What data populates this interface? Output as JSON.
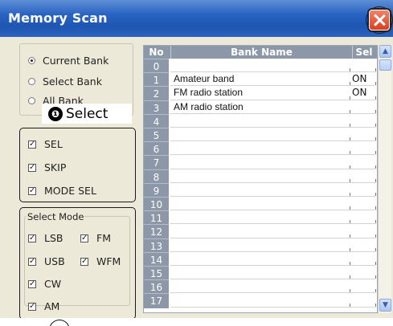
{
  "window": {
    "title": "Memory Scan"
  },
  "scan_target": {
    "options": [
      "Current Bank",
      "Select Bank",
      "All Bank"
    ],
    "selected_index": 0
  },
  "callout": {
    "number": "❶",
    "label": "Select"
  },
  "scan_options": [
    {
      "label": "SEL",
      "checked": true
    },
    {
      "label": "SKIP",
      "checked": true
    },
    {
      "label": "MODE SEL",
      "checked": true
    }
  ],
  "select_mode": {
    "legend": "Select Mode",
    "modes": [
      {
        "label": "LSB",
        "checked": true
      },
      {
        "label": "FM",
        "checked": true
      },
      {
        "label": "USB",
        "checked": true
      },
      {
        "label": "WFM",
        "checked": true
      },
      {
        "label": "CW",
        "checked": true
      },
      {
        "label": "AM",
        "checked": true
      }
    ]
  },
  "table": {
    "headers": {
      "no": "No",
      "bank_name": "Bank Name",
      "sel": "Sel"
    },
    "rows": [
      {
        "no": "0",
        "name": "",
        "sel": ""
      },
      {
        "no": "1",
        "name": "Amateur band",
        "sel": "ON"
      },
      {
        "no": "2",
        "name": "FM radio station",
        "sel": "ON"
      },
      {
        "no": "3",
        "name": "AM radio station",
        "sel": ""
      },
      {
        "no": "4",
        "name": "",
        "sel": ""
      },
      {
        "no": "5",
        "name": "",
        "sel": ""
      },
      {
        "no": "6",
        "name": "",
        "sel": ""
      },
      {
        "no": "7",
        "name": "",
        "sel": ""
      },
      {
        "no": "8",
        "name": "",
        "sel": ""
      },
      {
        "no": "9",
        "name": "",
        "sel": ""
      },
      {
        "no": "10",
        "name": "",
        "sel": ""
      },
      {
        "no": "11",
        "name": "",
        "sel": ""
      },
      {
        "no": "12",
        "name": "",
        "sel": ""
      },
      {
        "no": "13",
        "name": "",
        "sel": ""
      },
      {
        "no": "14",
        "name": "",
        "sel": ""
      },
      {
        "no": "15",
        "name": "",
        "sel": ""
      },
      {
        "no": "16",
        "name": "",
        "sel": ""
      },
      {
        "no": "17",
        "name": "",
        "sel": ""
      }
    ]
  },
  "icons": {
    "close": "close-icon",
    "scroll_up": "chevron-up-icon",
    "scroll_down": "chevron-down-icon"
  },
  "colors": {
    "title_bar": "#2a64c2",
    "close_button": "#d9401f",
    "table_header": "#8c97a7",
    "dialog_bg": "#ece9d8"
  }
}
